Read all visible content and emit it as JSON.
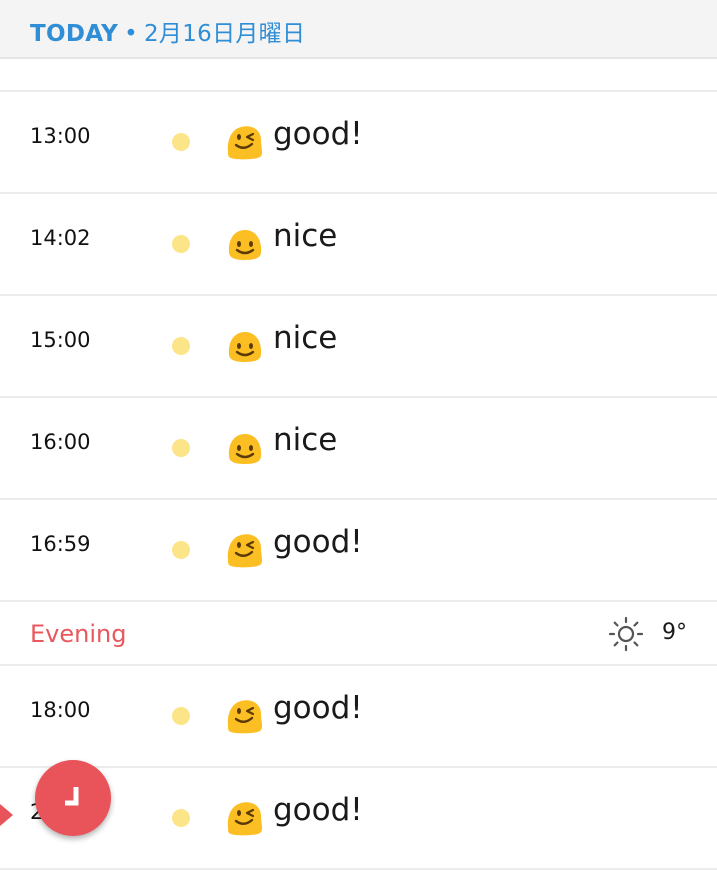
{
  "header": {
    "today_label": "TODAY",
    "separator": "•",
    "date": "2月16日月曜日"
  },
  "colors": {
    "accent_blue": "#2f8ed6",
    "section_red": "#e8585d",
    "fab_red": "#e9545b",
    "mood_dot": "#fbe588",
    "emoji_yellow": "#fbbf24"
  },
  "entries_afternoon": [
    {
      "time": "13:00",
      "mood": "good!",
      "emoji": "winking-face-icon"
    },
    {
      "time": "14:02",
      "mood": "nice",
      "emoji": "smiling-face-icon"
    },
    {
      "time": "15:00",
      "mood": "nice",
      "emoji": "smiling-face-icon"
    },
    {
      "time": "16:00",
      "mood": "nice",
      "emoji": "smiling-face-icon"
    },
    {
      "time": "16:59",
      "mood": "good!",
      "emoji": "winking-face-icon"
    }
  ],
  "evening": {
    "label": "Evening",
    "weather_icon": "sun-icon",
    "temperature": "9°"
  },
  "entries_evening": [
    {
      "time": "18:00",
      "mood": "good!",
      "emoji": "winking-face-icon"
    },
    {
      "time": "2",
      "mood": "good!",
      "emoji": "winking-face-icon"
    }
  ],
  "fab": {
    "icon": "clock-icon"
  }
}
